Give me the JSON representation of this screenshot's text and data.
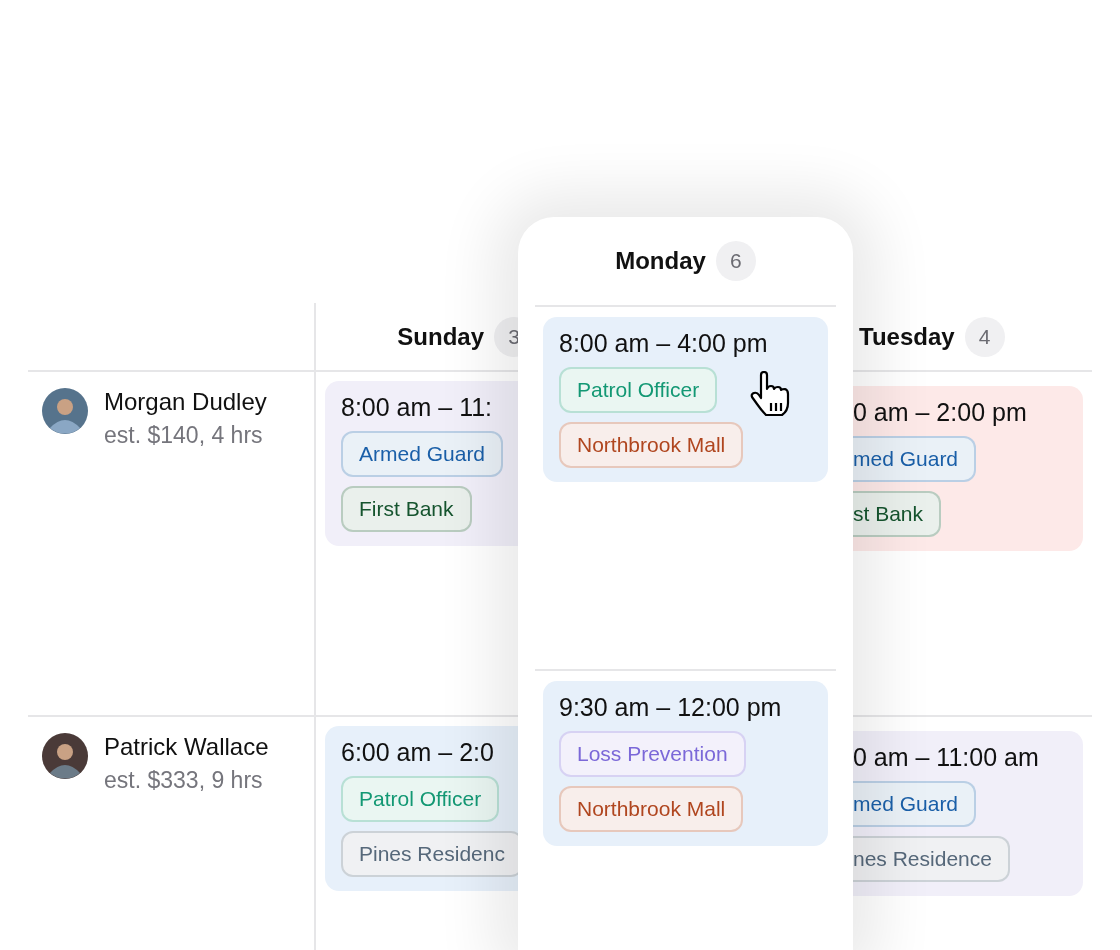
{
  "grid": {
    "days": [
      {
        "day": "Sunday",
        "count": "3",
        "kind": "left"
      },
      {
        "day": "Tuesday",
        "count": "4",
        "kind": "right"
      }
    ],
    "staff": [
      {
        "name": "Morgan Dudley",
        "estimate": "est. $140, 4 hrs",
        "shifts": [
          {
            "time": "8:00 am – 11:",
            "color": "#f1eff9",
            "tags": [
              {
                "label": "Armed Guard",
                "color": "#1a5fa8"
              },
              {
                "label": "First Bank",
                "color": "#15542e"
              }
            ]
          },
          {
            "time": "0 am – 2:00 pm",
            "color": "#fde9e8",
            "tags": [
              {
                "label": "med Guard",
                "color": "#1a5fa8"
              },
              {
                "label": "st Bank",
                "color": "#15542e"
              }
            ]
          }
        ]
      },
      {
        "name": "Patrick Wallace",
        "estimate": "est. $333, 9 hrs",
        "shifts": [
          {
            "time": "6:00 am – 2:0",
            "color": "#e7f0fa",
            "tags": [
              {
                "label": "Patrol Officer",
                "color": "#139874"
              },
              {
                "label": "Pines Residenc",
                "color": "#56687a"
              }
            ]
          },
          {
            "time": "0 am – 11:00 am",
            "color": "#f1eff9",
            "tags": [
              {
                "label": "med Guard",
                "color": "#1a5fa8"
              },
              {
                "label": "nes Residence",
                "color": "#56687a"
              }
            ]
          }
        ]
      }
    ]
  },
  "monday": {
    "day": "Monday",
    "count": "6",
    "shifts": [
      {
        "time": "8:00 am – 4:00 pm",
        "color": "#e7f0fa",
        "tags": [
          {
            "label": "Patrol Officer",
            "color": "#139874"
          },
          {
            "label": "Northbrook Mall",
            "color": "#b0461f"
          }
        ]
      },
      {
        "time": "9:30 am – 12:00 pm",
        "color": "#e7f0fa",
        "tags": [
          {
            "label": "Loss Prevention",
            "color": "#7b68d8"
          },
          {
            "label": "Northbrook Mall",
            "color": "#b0461f"
          }
        ]
      }
    ]
  }
}
